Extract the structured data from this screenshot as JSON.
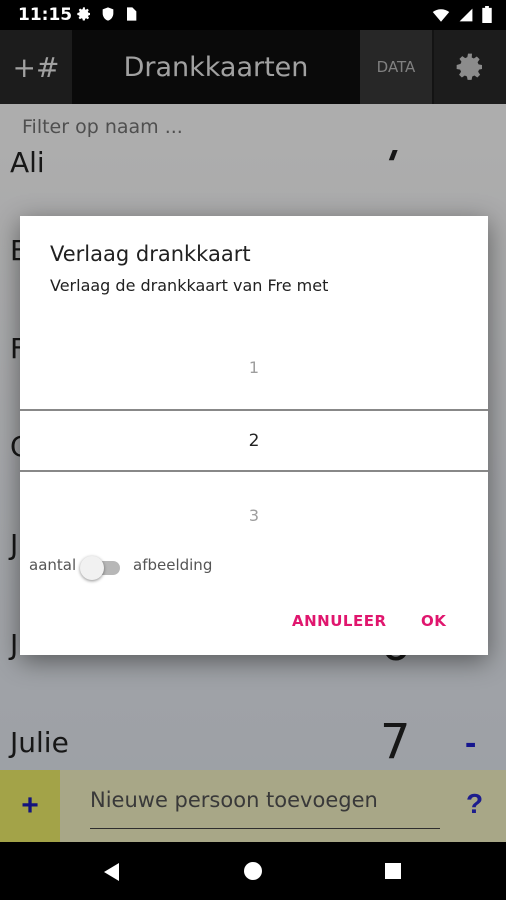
{
  "status_bar": {
    "time": "11:15",
    "icons_left": [
      "gear-icon",
      "shield-icon",
      "sim-card-icon"
    ],
    "icons_right": [
      "wifi-icon",
      "signal-icon",
      "battery-icon"
    ]
  },
  "toolbar": {
    "add_number_label": "+#",
    "title": "Drankkaarten",
    "data_label": "DATA",
    "settings_icon": "gear-icon"
  },
  "filter": {
    "placeholder": "Filter op naam ..."
  },
  "background_list": [
    {
      "name": "Ali",
      "count": "7"
    },
    {
      "name": "B",
      "count": ""
    },
    {
      "name": "F",
      "count": ""
    },
    {
      "name": "C",
      "count": ""
    },
    {
      "name": "J",
      "count": ""
    },
    {
      "name": "Julie",
      "count": "6"
    },
    {
      "name": "Julie",
      "count": "7",
      "minus": "-"
    }
  ],
  "dialog": {
    "title": "Verlaag drankkaart",
    "subtitle": "Verlaag de drankkaart van Fre met",
    "picker": {
      "above": "1",
      "selected": "2",
      "below": "3"
    },
    "toggle_left_label": "aantal",
    "toggle_right_label": "afbeelding",
    "cancel_label": "ANNULEER",
    "ok_label": "OK"
  },
  "bottom": {
    "add_label": "+",
    "new_person_placeholder": "Nieuwe persoon toevoegen",
    "help_label": "?"
  },
  "navigation": {
    "icons": [
      "back-icon",
      "home-icon",
      "recents-icon"
    ]
  },
  "colors": {
    "accent": "#e0166e",
    "bottom_bar": "#f8f7c8",
    "plus": "#1e1eb8"
  }
}
